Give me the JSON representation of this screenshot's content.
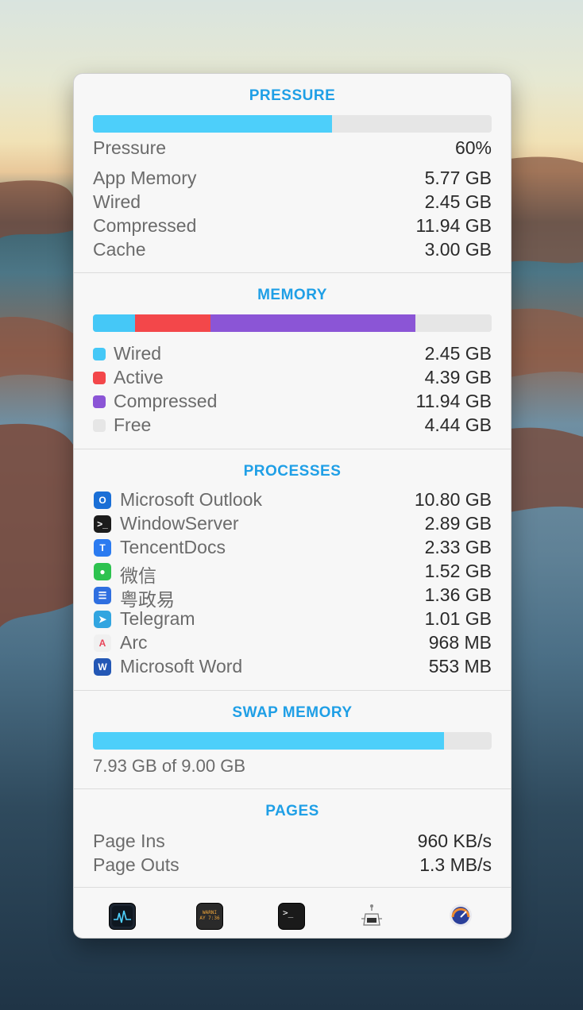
{
  "pressure": {
    "title": "PRESSURE",
    "fraction": 0.6,
    "bar_color": "#4dcffa",
    "rows": [
      {
        "label": "Pressure",
        "value": "60%"
      },
      {
        "label": "App Memory",
        "value": "5.77 GB"
      },
      {
        "label": "Wired",
        "value": "2.45 GB"
      },
      {
        "label": "Compressed",
        "value": "11.94 GB"
      },
      {
        "label": "Cache",
        "value": "3.00 GB"
      }
    ]
  },
  "memory": {
    "title": "MEMORY",
    "segments": [
      {
        "label": "Wired",
        "value": "2.45 GB",
        "gb": 2.45,
        "color": "#45c8f7"
      },
      {
        "label": "Active",
        "value": "4.39 GB",
        "gb": 4.39,
        "color": "#f3474a"
      },
      {
        "label": "Compressed",
        "value": "11.94 GB",
        "gb": 11.94,
        "color": "#8b55d6"
      },
      {
        "label": "Free",
        "value": "4.44 GB",
        "gb": 4.44,
        "color": "#e6e6e6"
      }
    ]
  },
  "processes": {
    "title": "PROCESSES",
    "items": [
      {
        "name": "Microsoft Outlook",
        "value": "10.80 GB",
        "icon": "outlook-icon",
        "color": "#1a6fd6"
      },
      {
        "name": "WindowServer",
        "value": "2.89 GB",
        "icon": "terminal-icon",
        "color": "#1c1c1c"
      },
      {
        "name": "TencentDocs",
        "value": "2.33 GB",
        "icon": "tencentdocs-icon",
        "color": "#2b7bf0"
      },
      {
        "name": "微信",
        "value": "1.52 GB",
        "icon": "wechat-icon",
        "color": "#2dc24f"
      },
      {
        "name": "粤政易",
        "value": "1.36 GB",
        "icon": "yuezhengyi-icon",
        "color": "#2f6fe0"
      },
      {
        "name": "Telegram",
        "value": "1.01 GB",
        "icon": "telegram-icon",
        "color": "#32a5e0"
      },
      {
        "name": "Arc",
        "value": "968 MB",
        "icon": "arc-icon",
        "color": "#f0f0f0"
      },
      {
        "name": "Microsoft Word",
        "value": "553 MB",
        "icon": "word-icon",
        "color": "#2357b5"
      }
    ]
  },
  "swap": {
    "title": "SWAP MEMORY",
    "fraction": 0.881,
    "bar_color": "#4dcffa",
    "text": "7.93 GB of 9.00 GB"
  },
  "pages": {
    "title": "PAGES",
    "rows": [
      {
        "label": "Page Ins",
        "value": "960 KB/s"
      },
      {
        "label": "Page Outs",
        "value": "1.3 MB/s"
      }
    ]
  },
  "dock": [
    {
      "icon": "activity-monitor-icon"
    },
    {
      "icon": "console-icon",
      "text": "WARNI\nAY 7:36"
    },
    {
      "icon": "terminal-icon"
    },
    {
      "icon": "system-information-icon"
    },
    {
      "icon": "speed-gauge-icon"
    }
  ]
}
